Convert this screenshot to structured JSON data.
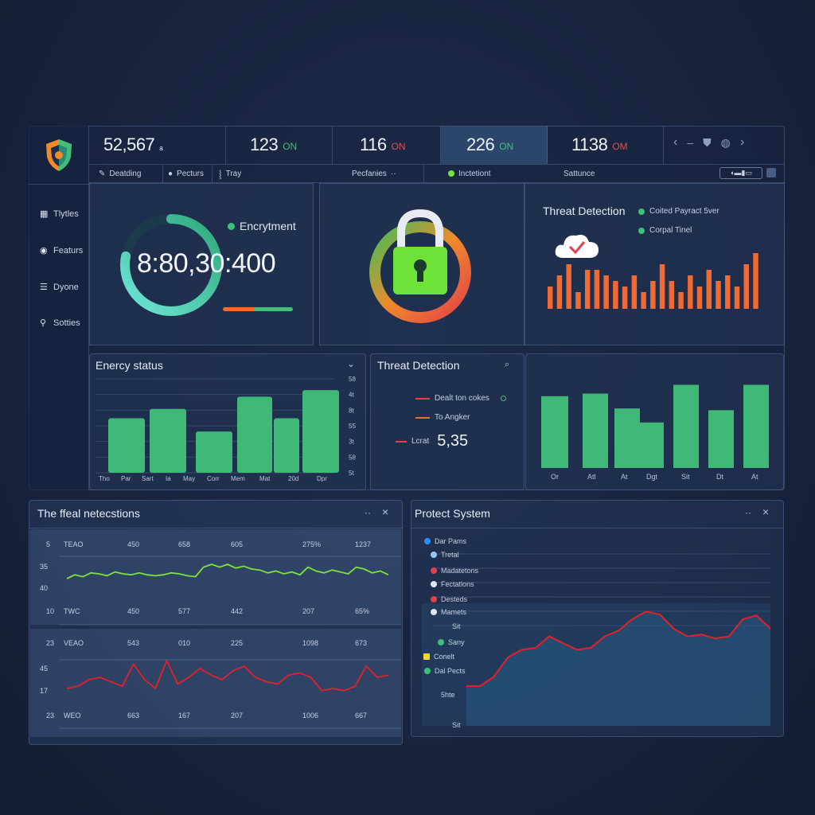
{
  "colors": {
    "accent_green": "#3fbf7a",
    "accent_orange": "#f06a35",
    "accent_red": "#e23a3a",
    "accent_teal": "#4ad6c8",
    "lime": "#7de23a"
  },
  "stats": [
    {
      "value": "52,567",
      "suffix": "ₐ",
      "unit": ""
    },
    {
      "value": "123",
      "unit": "ON",
      "unit_color": "#3fbf7a"
    },
    {
      "value": "116",
      "unit": "ON",
      "unit_color": "#e0504a"
    },
    {
      "value": "226",
      "unit": "ON",
      "unit_color": "#3fbf7a"
    },
    {
      "value": "1138",
      "unit": "OM",
      "unit_color": "#e0504a"
    }
  ],
  "nav_icons": [
    "chevron-left-icon",
    "minus-icon",
    "shield-icon",
    "globe-icon",
    "chevron-right-icon"
  ],
  "sidebar": {
    "items": [
      {
        "icon": "grid-icon",
        "label": "Tlytles"
      },
      {
        "icon": "circle-icon",
        "label": "Featurs"
      },
      {
        "icon": "doc-icon",
        "label": "Dyone"
      },
      {
        "icon": "key-icon",
        "label": "Sotties"
      }
    ]
  },
  "tabs": [
    {
      "label": "Deatding"
    },
    {
      "label": "Pecturs"
    },
    {
      "label": "Tray"
    },
    {
      "label": "Pecfanies"
    },
    {
      "label": "Inctetiont"
    },
    {
      "label": "Sattunce"
    }
  ],
  "encryption": {
    "legend": "Encrytment",
    "big_value": "8:80,30:400",
    "ring_progress": 0.78
  },
  "threat_top": {
    "title": "Threat Detection",
    "legend": [
      "Coited Payract 5ver",
      "Corpal Tinel"
    ],
    "chart_data": {
      "type": "bar",
      "values": [
        4,
        6,
        8,
        3,
        7,
        7,
        6,
        5,
        4,
        6,
        3,
        5,
        8,
        5,
        3,
        6,
        4,
        7,
        5,
        6,
        4,
        8,
        10
      ]
    }
  },
  "energy_status": {
    "title": "Enercy status",
    "chart_data": {
      "type": "bar",
      "categories": [
        "Tho",
        "Par",
        "Sart",
        "Ia",
        "May",
        "Corr",
        "Mem",
        "Mat",
        "20d",
        "Dpr"
      ],
      "values": [
        58,
        68,
        44,
        81,
        58,
        88
      ],
      "ytick_labels": [
        "58",
        "4t",
        "8t",
        "55",
        "3t",
        "58",
        "5t"
      ]
    }
  },
  "threat_mid": {
    "title": "Threat Detection",
    "rows": [
      {
        "label": "Dealt ton cokes"
      },
      {
        "label": "To Angker"
      }
    ],
    "lower_label": "Lcrat",
    "lower_value": "5,35"
  },
  "right_bars": {
    "chart_data": {
      "type": "bar",
      "categories": [
        "Or",
        "Atl",
        "At",
        "Dgt",
        "Sit",
        "Dt",
        "At"
      ],
      "values": [
        82,
        85,
        68,
        52,
        95,
        66,
        95
      ]
    }
  },
  "detections": {
    "title": "The ffeal netecstions",
    "row1_labels": [
      "5",
      "TEAO",
      "450",
      "658",
      "605",
      "275%",
      "1237"
    ],
    "row1_y": [
      "35",
      "40"
    ],
    "row1_bottom": [
      "10",
      "TWC",
      "450",
      "577",
      "442",
      "207",
      "65%"
    ],
    "row2_labels": [
      "23",
      "VEAO",
      "543",
      "010",
      "225",
      "1098",
      "673"
    ],
    "row2_y": [
      "45",
      "17"
    ],
    "row2_bottom": [
      "23",
      "WEO",
      "663",
      "167",
      "207",
      "1006",
      "667"
    ],
    "chart_data": [
      {
        "type": "line",
        "name": "",
        "values": [
          40,
          44,
          42,
          46,
          45,
          43,
          47,
          45,
          44,
          46,
          44,
          43,
          44,
          46,
          45,
          43,
          42,
          52,
          55,
          52,
          55,
          51,
          53,
          50,
          49,
          46,
          48,
          45,
          47,
          44,
          52,
          48,
          46,
          49,
          47,
          45,
          52,
          50,
          46,
          48,
          44
        ]
      },
      {
        "type": "line",
        "name": "",
        "values": [
          20,
          22,
          28,
          30,
          26,
          22,
          42,
          28,
          20,
          45,
          24,
          30,
          38,
          32,
          28,
          36,
          40,
          30,
          26,
          24,
          32,
          34,
          30,
          18,
          20,
          18,
          22,
          40,
          30,
          32
        ]
      }
    ]
  },
  "protect": {
    "title": "Protect System",
    "legend": [
      {
        "label": "Dar Pams",
        "color": "#2e8df0"
      },
      {
        "label": "Tretal",
        "color": "#8fc7ff"
      },
      {
        "label": "Madatetons",
        "color": "#e2414a"
      },
      {
        "label": "Fectatlons",
        "color": "#dfe7f3"
      },
      {
        "label": "Desteds",
        "color": "#e2414a"
      },
      {
        "label": "Mamets",
        "color": "#dfe7f3"
      },
      {
        "label": "Sany",
        "color": "#3fbf7a"
      },
      {
        "label": "Conelt",
        "color": "#f2d33a"
      },
      {
        "label": "Dal Pects",
        "color": "#3fbf7a"
      }
    ],
    "ytick_top": "Sit",
    "ytick_mid": "5hte",
    "ytick_bottom": "Sit",
    "chart_data": {
      "type": "area",
      "values": [
        10,
        10,
        20,
        40,
        48,
        50,
        62,
        55,
        48,
        50,
        62,
        68,
        80,
        88,
        85,
        70,
        62,
        64,
        60,
        62,
        80,
        84,
        70
      ]
    }
  }
}
